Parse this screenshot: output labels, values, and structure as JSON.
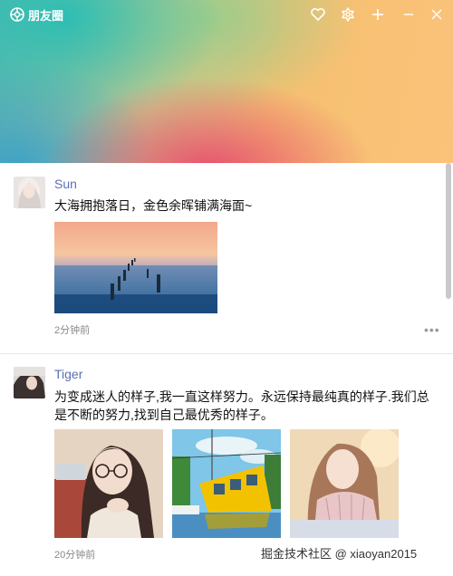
{
  "window": {
    "title": "朋友圈"
  },
  "posts": [
    {
      "username": "Sun",
      "content": "大海拥抱落日，金色余晖铺满海面~",
      "time": "2分钟前",
      "more": "•••"
    },
    {
      "username": "Tiger",
      "content": "为变成迷人的样子,我一直这样努力。永远保持最纯真的样子.我们总是不断的努力,找到自己最优秀的样子。",
      "time": "20分钟前"
    }
  ],
  "watermark": "掘金技术社区 @ xiaoyan2015",
  "icons": {
    "app": "aperture-icon",
    "like": "heart-icon",
    "skin": "settings-icon",
    "add": "plus-icon",
    "minimize": "minimize-icon",
    "close": "close-icon"
  },
  "colors": {
    "username": "#5a6fb5"
  }
}
